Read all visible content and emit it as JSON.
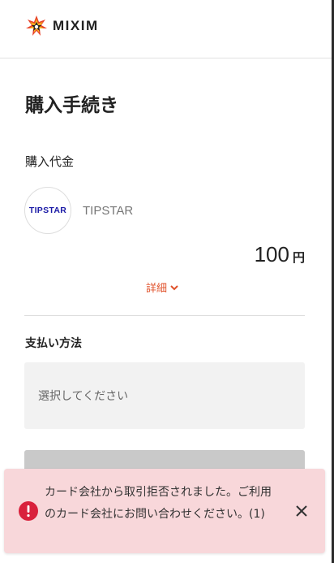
{
  "header": {
    "brand": "MIXIM"
  },
  "page": {
    "title": "購入手続き"
  },
  "purchase": {
    "label": "購入代金",
    "product_logo_text": "TIPSTAR",
    "product_name": "TIPSTAR",
    "price": "100",
    "currency": "円",
    "details_label": "詳細"
  },
  "payment": {
    "label": "支払い方法",
    "select_placeholder": "選択してください"
  },
  "error_toast": {
    "message": "カード会社から取引拒否されました。ご利用のカード会社にお問い合わせください。(1)"
  },
  "colors": {
    "accent": "#e0522b",
    "error_icon": "#d9213c",
    "toast_bg": "#f8d7da",
    "logo_text": "#1a1aa6"
  },
  "icons": [
    "mixim-logo-icon",
    "chevron-down-icon",
    "error-icon",
    "close-icon"
  ]
}
